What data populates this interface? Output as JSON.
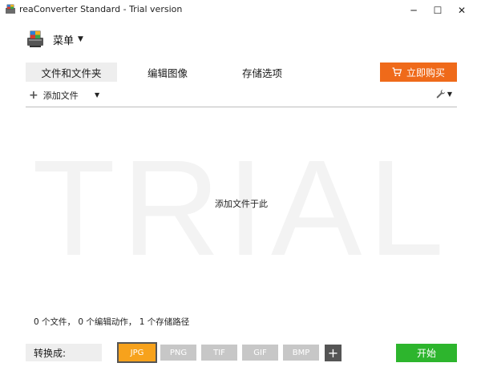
{
  "window": {
    "title": "reaConverter Standard - Trial version",
    "minimize": "─",
    "maximize": "☐",
    "close": "✕"
  },
  "menu": {
    "label": "菜单",
    "caret": "▼"
  },
  "tabs": [
    {
      "label": "文件和文件夹",
      "active": true
    },
    {
      "label": "编辑图像",
      "active": false
    },
    {
      "label": "存储选项",
      "active": false
    }
  ],
  "buy": {
    "label": "立即购买"
  },
  "toolbar": {
    "add_label": "添加文件",
    "add_icon": "+",
    "caret": "▼"
  },
  "dropzone": {
    "watermark": "TRIAL",
    "hint": "添加文件于此"
  },
  "status": "0 个文件， 0 个编辑动作， 1 个存储路径",
  "convert": {
    "label": "转换成:",
    "formats": [
      "JPG",
      "PNG",
      "TIF",
      "GIF",
      "BMP"
    ],
    "selected": "JPG",
    "add_format": "+",
    "start_label": "开始"
  },
  "colors": {
    "accent_orange": "#ef6a1a",
    "selected_format": "#f7a21c",
    "start_green": "#2db52d"
  },
  "icons": {
    "app": "app-logo-icon",
    "menu": "printer-menu-icon",
    "cart": "cart-icon",
    "add": "plus-icon",
    "tools": "wrench-icon"
  }
}
